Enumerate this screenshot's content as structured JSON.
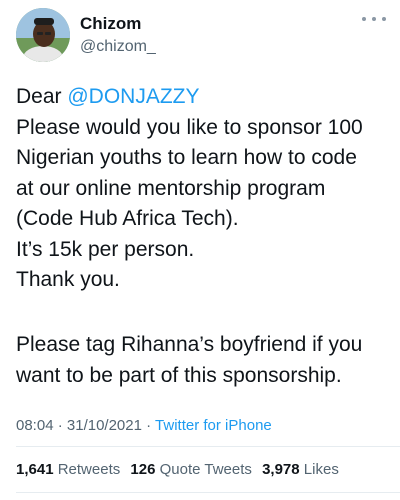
{
  "author": {
    "name": "Chizom",
    "handle": "@chizom_"
  },
  "tweet": {
    "line1_prefix": "Dear ",
    "mention": "@DONJAZZY",
    "lines": [
      "Please would you like to sponsor 100",
      "Nigerian youths to learn how to code",
      "at our online mentorship program",
      "(Code Hub Africa Tech).",
      "It’s 15k per person.",
      "Thank you."
    ],
    "paragraph2": [
      "Please tag Rihanna’s boyfriend if you",
      "want to be part of this sponsorship."
    ]
  },
  "meta": {
    "time": "08:04",
    "separator": " · ",
    "date": "31/10/2021",
    "separator2": " · ",
    "source": "Twitter for iPhone"
  },
  "stats": {
    "retweets_count": "1,641",
    "retweets_label": "Retweets",
    "quotes_count": "126",
    "quotes_label": "Quote Tweets",
    "likes_count": "3,978",
    "likes_label": "Likes"
  },
  "colors": {
    "accent": "#1d9bf0",
    "text": "#0f1419",
    "secondary": "#536471"
  },
  "icons": {
    "more": "more-dots-icon"
  }
}
